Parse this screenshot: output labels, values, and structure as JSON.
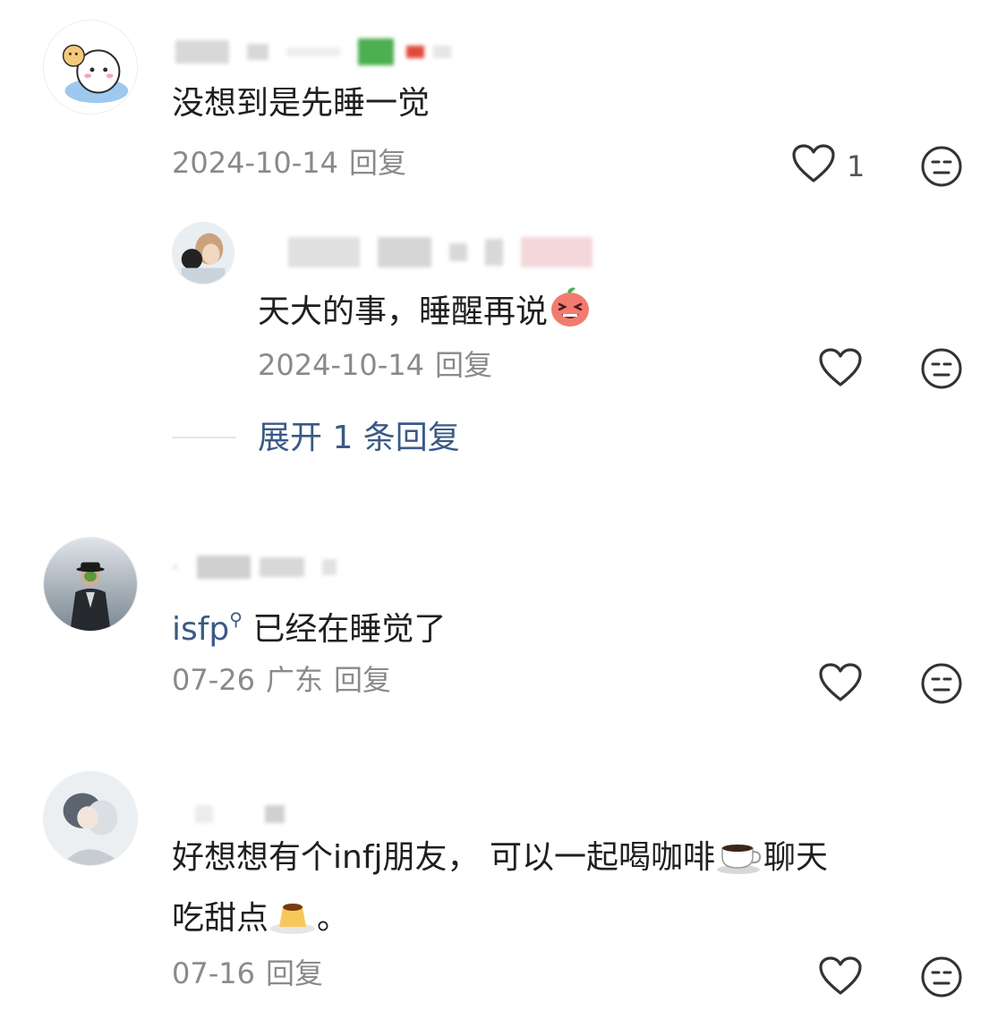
{
  "comments": [
    {
      "text": "没想到是先睡一觉",
      "date": "2024-10-14",
      "reply_label": "回复",
      "like_count": "1",
      "reply": {
        "text": "天大的事，睡醒再说",
        "date": "2024-10-14",
        "reply_label": "回复"
      },
      "expand_label": "展开 1 条回复"
    },
    {
      "tag": "isfp",
      "text": "已经在睡觉了",
      "date": "07-26",
      "location": "广东",
      "reply_label": "回复"
    },
    {
      "text_line1": "好想想有个infj朋友， 可以一起喝咖啡",
      "text_line1_tail": "聊天",
      "text_line2": "吃甜点",
      "text_line2_tail": "。",
      "date": "07-16",
      "reply_label": "回复"
    }
  ],
  "icons": {
    "like": "heart-outline-icon",
    "reaction": "neutral-face-icon",
    "coffee": "coffee-cup-emoji",
    "pudding": "pudding-emoji",
    "laugh": "laughing-peach-emoji"
  },
  "colors": {
    "accent_link": "#3a5a86",
    "meta_gray": "#8a8a8a",
    "text": "#1f1f1f"
  }
}
